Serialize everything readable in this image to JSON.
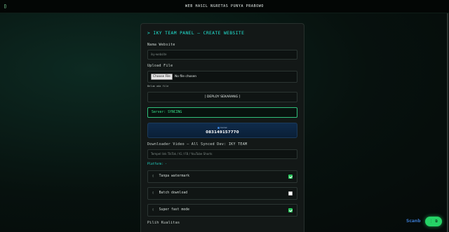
{
  "header": {
    "menu_icon": "▯",
    "title": "WEB HASIL NGRETAS PUNYA PRABOWO"
  },
  "panel": {
    "title": "> IKY TEAM PANEL — CREATE WEBSITE",
    "name_label": "Nama Website",
    "name_placeholder": "iky-website",
    "upload_label": "Upload File",
    "file_button": "Choose File",
    "file_status": "No file chosen",
    "file_hint": "Belum ada file",
    "deploy_label": "[ DEPLOY SEKARANG ]",
    "status_text": "Server: SYNCING",
    "phone_mini": "Kontak",
    "phone_number": "083149157770",
    "downloader_label": "Downloader Video — All Synced Dev: IKY TEAM",
    "downloader_placeholder": "Tempel link TikTok / IG / FB / YouTube Shorts",
    "platform_text": "Platform: -",
    "options": [
      {
        "icon": "▯",
        "label": "Tanpa watermark",
        "checked": true
      },
      {
        "icon": "▯",
        "label": "Batch download",
        "checked": false
      },
      {
        "icon": "▯",
        "label": "Super fast mode",
        "checked": true
      }
    ],
    "quality_label": "Pilih Kualitas"
  },
  "overlay": {
    "watermark": "Scanb",
    "fab_label": "⋮ ⧉"
  },
  "colors": {
    "accent": "#22e3d2",
    "status_green": "#39e58c",
    "check_green": "#27c45a",
    "fab_green": "#25d366"
  }
}
